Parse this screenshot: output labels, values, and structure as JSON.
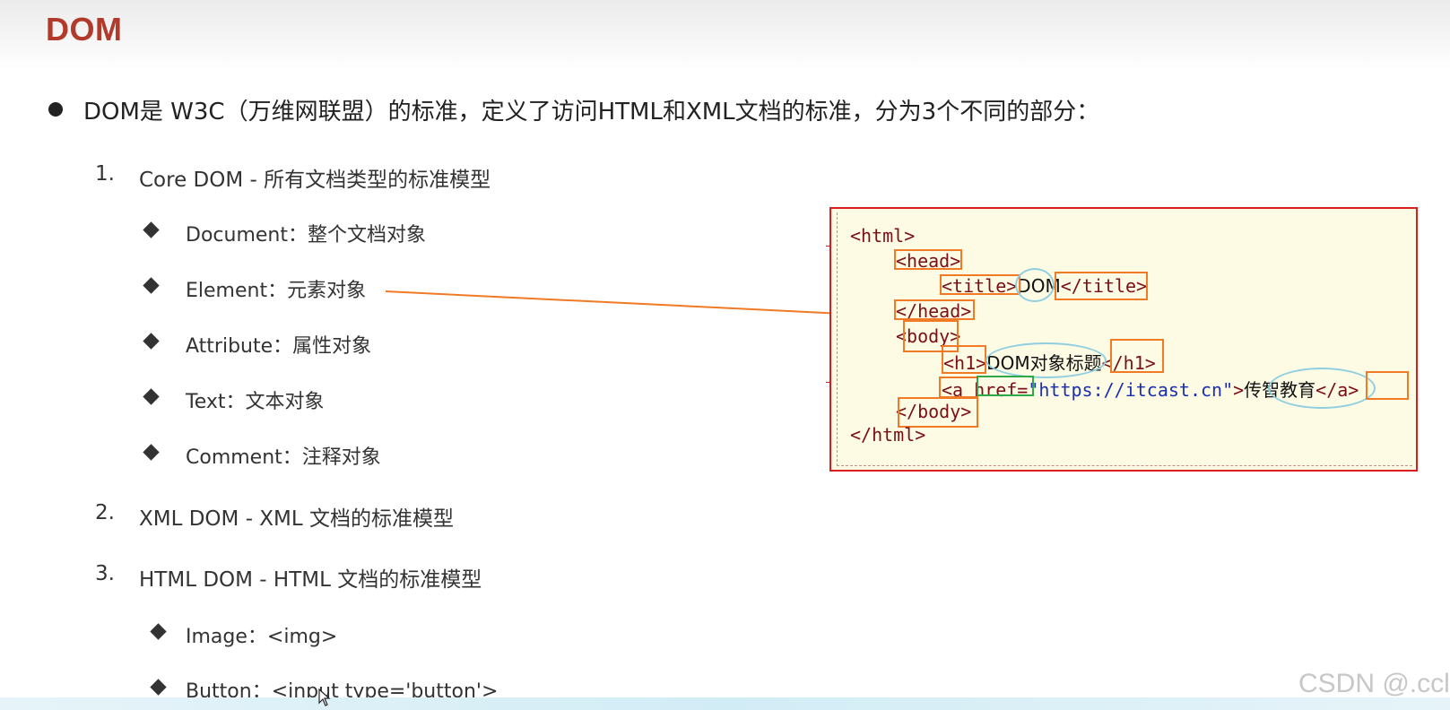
{
  "slide": {
    "title": "DOM",
    "intro": "DOM是 W3C（万维网联盟）的标准，定义了访问HTML和XML文档的标准，分为3个不同的部分：",
    "sections": [
      {
        "number": "1.",
        "label": "Core DOM - 所有文档类型的标准模型",
        "items": [
          "Document：整个文档对象",
          "Element：元素对象",
          "Attribute：属性对象",
          "Text：文本对象",
          "Comment：注释对象"
        ]
      },
      {
        "number": "2.",
        "label": "XML DOM - XML 文档的标准模型",
        "items": []
      },
      {
        "number": "3.",
        "label": "HTML DOM - HTML 文档的标准模型",
        "items": [
          "Image：<img>",
          "Button：<input type='button'>"
        ]
      }
    ]
  },
  "code_example": {
    "line1": "<html>",
    "line2": "<head>",
    "line3_open": "<title>",
    "line3_text": "DOM",
    "line3_close": "</title>",
    "line4": "</head>",
    "line5": "<body>",
    "line6_open": "<h1>",
    "line6_text": "DOM对象标题",
    "line6_close": "</h1>",
    "line7_open": "<a ",
    "line7_attr": "href",
    "line7_eq": "=",
    "line7_value": "\"https://itcast.cn\"",
    "line7_gt": ">",
    "line7_text": "传智教育",
    "line7_close": "</a>",
    "line8": "</body>",
    "line9": "</html>"
  },
  "watermark": "CSDN @.ccl",
  "colors": {
    "title": "#b13a2b",
    "panel_border": "#d81e1e",
    "panel_bg": "#fdfbe4",
    "tag": "#7a0f16",
    "string": "#1a2fb0",
    "tag_highlight": "#f07a25",
    "attr_highlight": "#2fa84a",
    "text_highlight": "#8fcfe0"
  }
}
